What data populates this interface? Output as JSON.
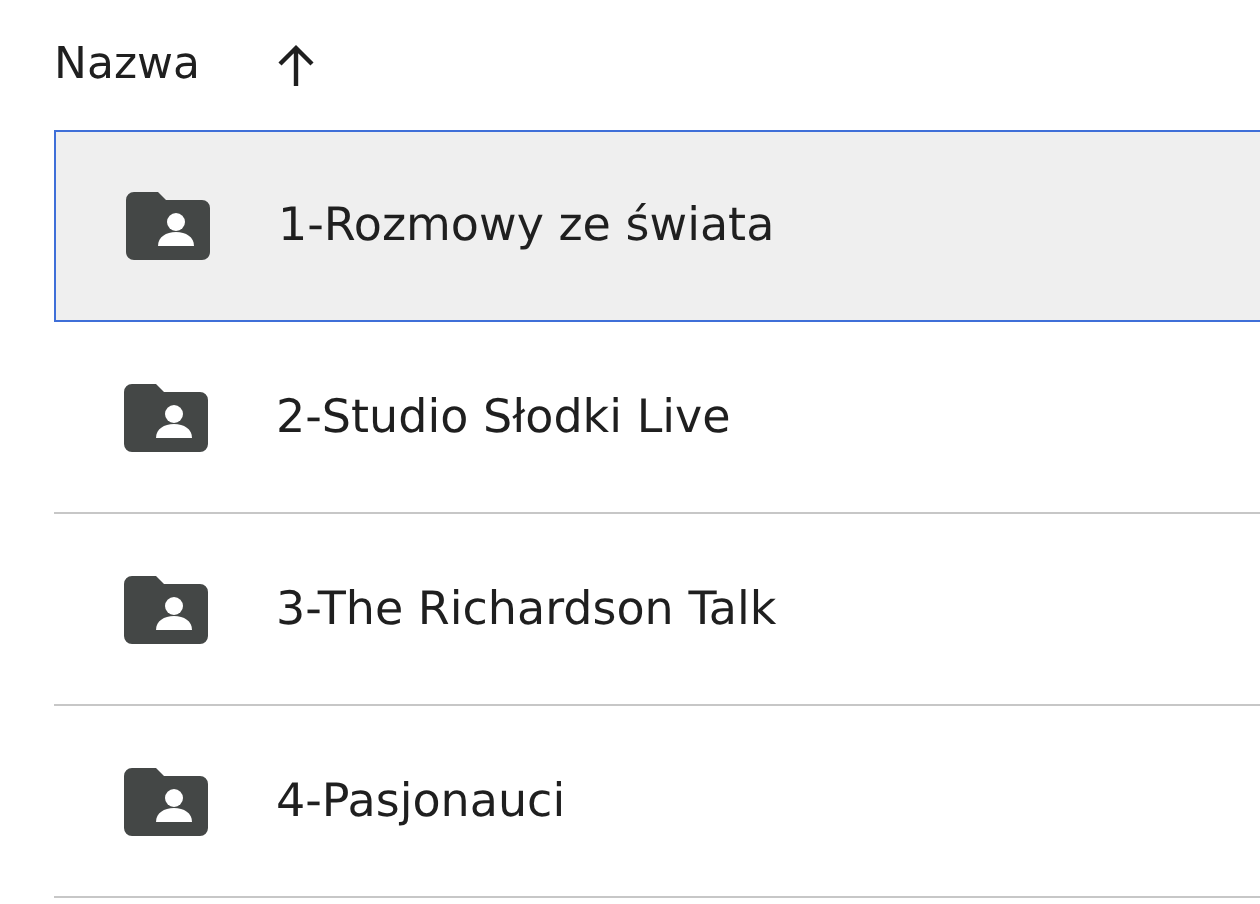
{
  "header": {
    "label": "Nazwa",
    "ascending": true
  },
  "rows": [
    {
      "name": "1-Rozmowy ze świata",
      "selected": true
    },
    {
      "name": "2-Studio Słodki Live",
      "selected": false
    },
    {
      "name": "3-The Richardson Talk",
      "selected": false
    },
    {
      "name": "4-Pasjonauci",
      "selected": false
    }
  ]
}
